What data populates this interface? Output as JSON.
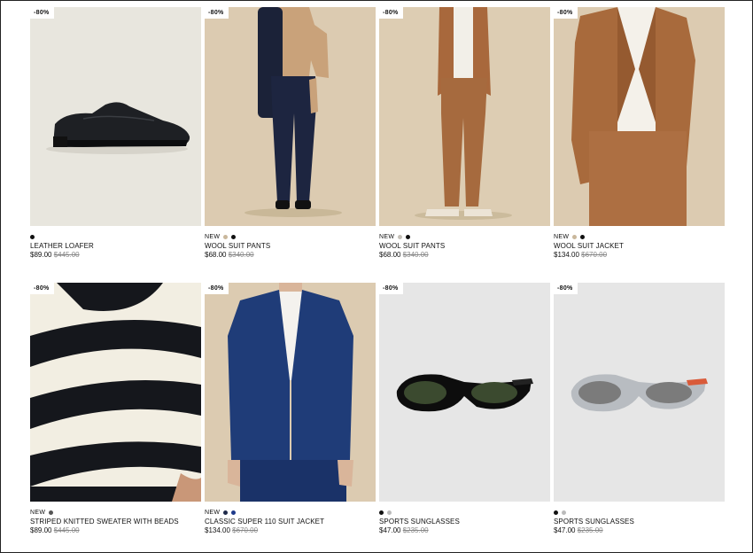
{
  "products": [
    {
      "badge": "-80%",
      "new": "",
      "swatches": [
        "#111111"
      ],
      "name": "LEATHER LOAFER",
      "price": "$89.00",
      "old_price": "$445.00",
      "bg": "#e8e6de"
    },
    {
      "badge": "-80%",
      "new": "NEW",
      "swatches": [
        "#c9b79b",
        "#111111"
      ],
      "name": "WOOL SUIT PANTS",
      "price": "$68.00",
      "old_price": "$340.00",
      "bg": "#dccbb1"
    },
    {
      "badge": "-80%",
      "new": "NEW",
      "swatches": [
        "#c4c0b8",
        "#111111"
      ],
      "name": "WOOL SUIT PANTS",
      "price": "$68.00",
      "old_price": "$340.00",
      "bg": "#ddcdb3"
    },
    {
      "badge": "-80%",
      "new": "NEW",
      "swatches": [
        "#c9b79b",
        "#111111"
      ],
      "name": "WOOL SUIT JACKET",
      "price": "$134.00",
      "old_price": "$670.00",
      "bg": "#dccbb1"
    },
    {
      "badge": "-80%",
      "new": "NEW",
      "swatches": [
        "#555555"
      ],
      "name": "STRIPED KNITTED SWEATER WITH BEADS",
      "price": "$89.00",
      "old_price": "$445.00",
      "bg": "#f2efe6"
    },
    {
      "badge": "-80%",
      "new": "NEW",
      "swatches": [
        "#1e2a4a",
        "#1e3a8a"
      ],
      "name": "CLASSIC SUPER 110 SUIT JACKET",
      "price": "$134.00",
      "old_price": "$670.00",
      "bg": "#dccbb1"
    },
    {
      "badge": "-80%",
      "new": "",
      "swatches": [
        "#111111",
        "#bbbbbb"
      ],
      "name": "SPORTS SUNGLASSES",
      "price": "$47.00",
      "old_price": "$235.00",
      "bg": "#e6e6e6"
    },
    {
      "badge": "-80%",
      "new": "",
      "swatches": [
        "#111111",
        "#bbbbbb"
      ],
      "name": "SPORTS SUNGLASSES",
      "price": "$47.00",
      "old_price": "$235.00",
      "bg": "#e6e6e6"
    }
  ]
}
